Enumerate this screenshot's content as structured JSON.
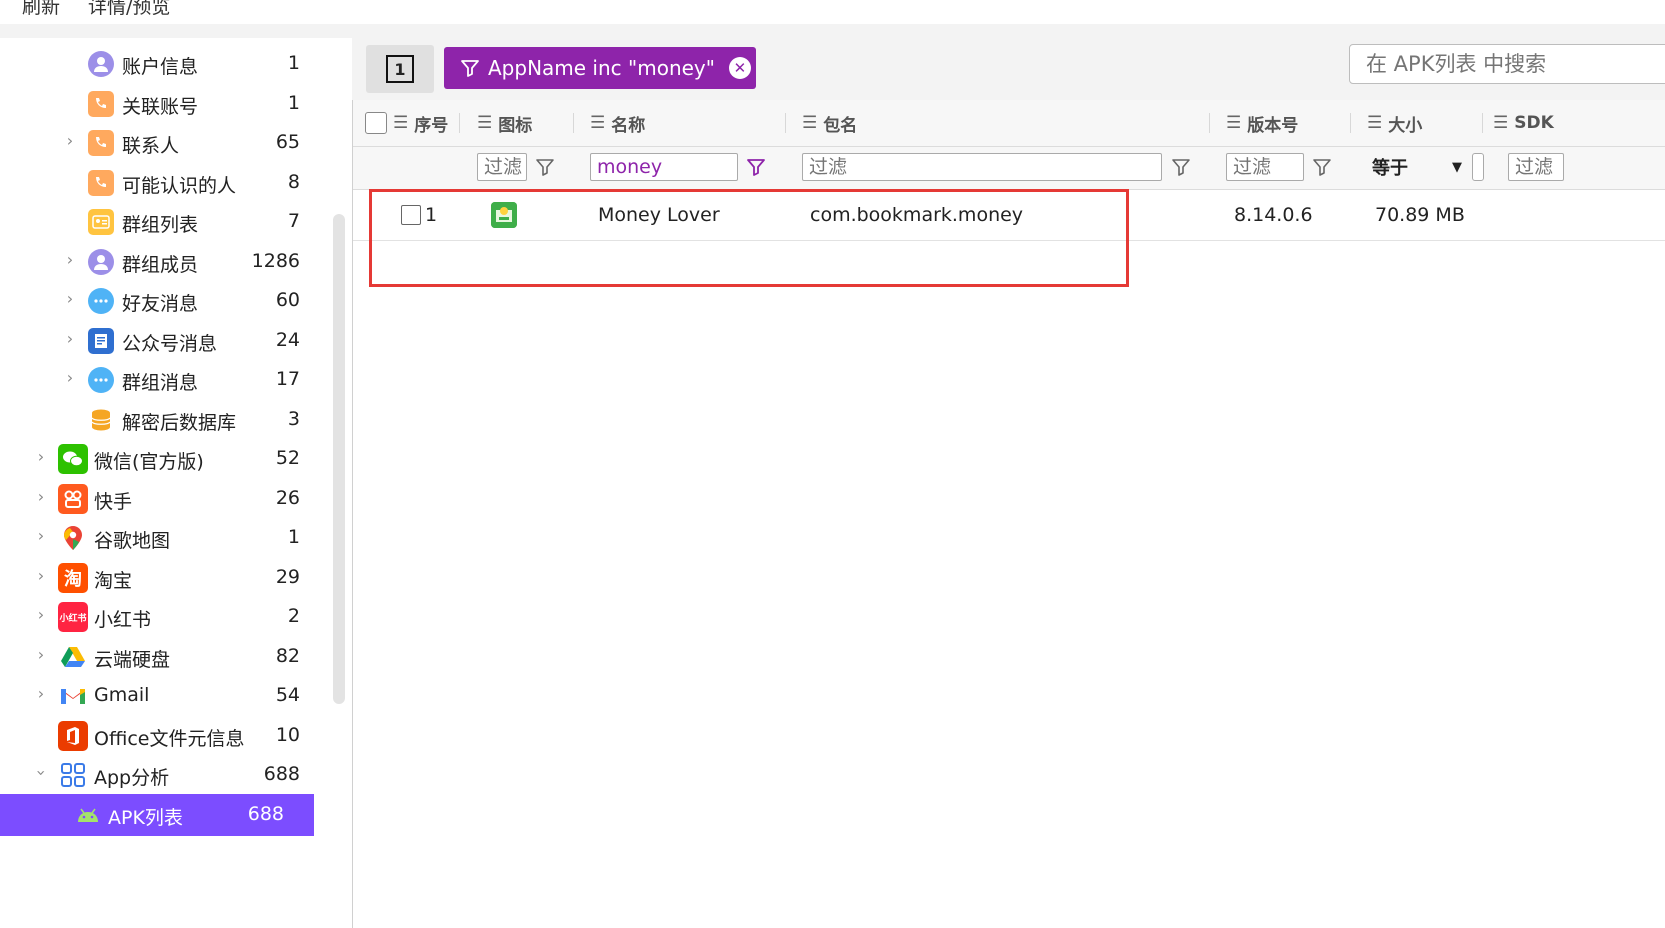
{
  "menu": {
    "refresh": "刷新",
    "details": "详情/预览"
  },
  "sidebar": {
    "items": [
      {
        "label": "账户信息",
        "count": "1",
        "icon": "user-icon",
        "expandable": false
      },
      {
        "label": "关联账号",
        "count": "1",
        "icon": "phone-icon",
        "expandable": false
      },
      {
        "label": "联系人",
        "count": "65",
        "icon": "phone-icon",
        "expandable": true
      },
      {
        "label": "可能认识的人",
        "count": "8",
        "icon": "phone-icon",
        "expandable": false
      },
      {
        "label": "群组列表",
        "count": "7",
        "icon": "id-card-icon",
        "expandable": false
      },
      {
        "label": "群组成员",
        "count": "1286",
        "icon": "user-icon",
        "expandable": true
      },
      {
        "label": "好友消息",
        "count": "60",
        "icon": "chat-bubble-icon",
        "expandable": true
      },
      {
        "label": "公众号消息",
        "count": "24",
        "icon": "document-icon",
        "expandable": true
      },
      {
        "label": "群组消息",
        "count": "17",
        "icon": "chat-bubble-icon",
        "expandable": true
      },
      {
        "label": "解密后数据库",
        "count": "3",
        "icon": "database-icon",
        "expandable": false
      },
      {
        "label": "微信(官方版)",
        "count": "52",
        "icon": "wechat-icon",
        "expandable": true
      },
      {
        "label": "快手",
        "count": "26",
        "icon": "kuaishou-icon",
        "expandable": true
      },
      {
        "label": "谷歌地图",
        "count": "1",
        "icon": "google-maps-icon",
        "expandable": true
      },
      {
        "label": "淘宝",
        "count": "29",
        "icon": "taobao-icon",
        "expandable": true
      },
      {
        "label": "小红书",
        "count": "2",
        "icon": "xiaohongshu-icon",
        "expandable": true
      },
      {
        "label": "云端硬盘",
        "count": "82",
        "icon": "google-drive-icon",
        "expandable": true
      },
      {
        "label": "Gmail",
        "count": "54",
        "icon": "gmail-icon",
        "expandable": true
      },
      {
        "label": "Office文件元信息",
        "count": "10",
        "icon": "office-icon",
        "expandable": false
      },
      {
        "label": "App分析",
        "count": "688",
        "icon": "app-grid-icon",
        "expandable": true,
        "expanded": true
      },
      {
        "label": "APK列表",
        "count": "688",
        "icon": "android-icon",
        "expandable": false,
        "selected": true
      }
    ],
    "taobao_glyph": "淘",
    "xhs_glyph": "小红书"
  },
  "toolbar": {
    "pin_label": "1",
    "filter_chip": "AppName inc \"money\"",
    "search_placeholder": "在 APK列表 中搜索"
  },
  "table": {
    "columns": [
      "序号",
      "图标",
      "名称",
      "包名",
      "版本号",
      "大小",
      "SDK"
    ],
    "filters": {
      "icon": "过滤",
      "name": "money",
      "package": "过滤",
      "version": "过滤",
      "size_op": "等于",
      "sdk": "过滤"
    },
    "rows": [
      {
        "index": "1",
        "name": "Money Lover",
        "package": "com.bookmark.money",
        "version": "8.14.0.6",
        "size": "70.89 MB"
      }
    ]
  },
  "colors": {
    "accent": "#7c4dff",
    "chip": "#8e24aa",
    "highlight": "#e53935"
  }
}
